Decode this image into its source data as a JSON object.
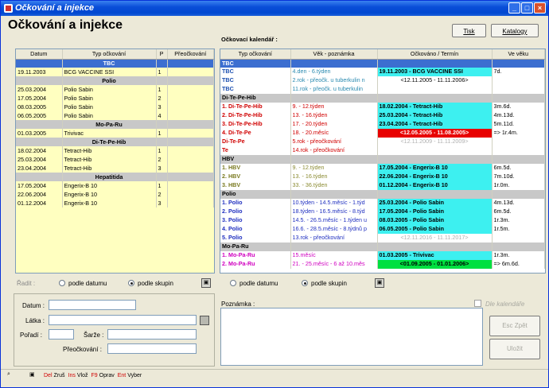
{
  "window": {
    "title": "Očkování a injekce"
  },
  "heading": "Očkování a injekce",
  "buttons": {
    "tisk": "Tisk",
    "katalogy": "Katalogy",
    "esc": "Esc Zpět",
    "ulozit": "Uložit"
  },
  "calendar_label": "Očkovací kalendář :",
  "left_table": {
    "headers": [
      "Datum",
      "Typ očkování",
      "P",
      "Přeočkování"
    ],
    "rows": [
      {
        "g": true,
        "t": "TBC",
        "sel": true
      },
      {
        "d": "19.11.2003",
        "t": "BCG VACCINE SSI",
        "p": "1"
      },
      {
        "g": true,
        "t": "Polio"
      },
      {
        "d": "25.03.2004",
        "t": "Polio Sabin",
        "p": "1"
      },
      {
        "d": "17.05.2004",
        "t": "Polio Sabin",
        "p": "2"
      },
      {
        "d": "08.03.2005",
        "t": "Polio Sabin",
        "p": "3"
      },
      {
        "d": "06.05.2005",
        "t": "Polio Sabin",
        "p": "4"
      },
      {
        "g": true,
        "t": "Mo-Pa-Ru"
      },
      {
        "d": "01.03.2005",
        "t": "Trivivac",
        "p": "1"
      },
      {
        "g": true,
        "t": "Di-Te-Pe-Hib"
      },
      {
        "d": "18.02.2004",
        "t": "Tetract-Hib",
        "p": "1"
      },
      {
        "d": "25.03.2004",
        "t": "Tetract-Hib",
        "p": "2"
      },
      {
        "d": "23.04.2004",
        "t": "Tetract-Hib",
        "p": "3"
      },
      {
        "g": true,
        "t": "Hepatitida"
      },
      {
        "d": "17.05.2004",
        "t": "Engerix-B 10",
        "p": "1"
      },
      {
        "d": "22.06.2004",
        "t": "Engerix-B 10",
        "p": "2"
      },
      {
        "d": "01.12.2004",
        "t": "Engerix-B 10",
        "p": "3"
      }
    ]
  },
  "right_table": {
    "headers": [
      "Typ očkování",
      "Věk - poznámka",
      "Očkováno / Termín",
      "Ve věku"
    ],
    "rows": [
      {
        "sel": true,
        "a": "TBC"
      },
      {
        "a": "TBC",
        "b": "4.den - 6.týden",
        "c": "19.11.2003 - BCG VACCINE SSI",
        "d": "7d.",
        "ac": "#1b4fb0",
        "bc": "#2a8ab0",
        "cc": "cyan"
      },
      {
        "a": "TBC",
        "b": "2.rok - přeočk. u tuberkulin n",
        "c": "<12.11.2005 - 11.11.2006>",
        "ac": "#1b4fb0",
        "bc": "#2a8ab0"
      },
      {
        "a": "TBC",
        "b": "11.rok - přeočk. u tuberkulin",
        "ac": "#1b4fb0",
        "bc": "#2a8ab0"
      },
      {
        "g": true,
        "a": "Di-Te-Pe-Hib"
      },
      {
        "a": "1. Di-Te-Pe-Hib",
        "b": "9. - 12.týden",
        "c": "18.02.2004 - Tetract-Hib",
        "d": "3m.6d.",
        "ac": "#d00000",
        "bc": "#d00000",
        "cc": "cyan"
      },
      {
        "a": "2. Di-Te-Pe-Hib",
        "b": "13. - 16.týden",
        "c": "25.03.2004 - Tetract-Hib",
        "d": "4m.13d.",
        "ac": "#d00000",
        "bc": "#d00000",
        "cc": "cyan"
      },
      {
        "a": "3. Di-Te-Pe-Hib",
        "b": "17. - 20.týden",
        "c": "23.04.2004 - Tetract-Hib",
        "d": "5m.11d.",
        "ac": "#d00000",
        "bc": "#d00000",
        "cc": "cyan"
      },
      {
        "a": "4. Di-Te-Pe",
        "b": "18. - 20.měsíc",
        "c": "<12.05.2005 - 11.08.2005>",
        "d": "=> 1r.4m.",
        "ac": "#d00000",
        "bc": "#d00000",
        "cc": "red"
      },
      {
        "a": "Di-Te-Pe",
        "b": "5.rok - přeočkování",
        "c": "<12.11.2009 - 11.11.2009>",
        "ac": "#d00000",
        "bc": "#d00000",
        "cg": true
      },
      {
        "a": "Te",
        "b": "14.rok - přeočkování",
        "ac": "#d00000",
        "bc": "#d00000"
      },
      {
        "g": true,
        "a": "HBV"
      },
      {
        "a": "1. HBV",
        "b": "9. - 12.týden",
        "c": "17.05.2004 - Engerix-B 10",
        "d": "6m.5d.",
        "ac": "#7a7a20",
        "bc": "#8a8a30",
        "cc": "cyan"
      },
      {
        "a": "2. HBV",
        "b": "13. - 16.týden",
        "c": "22.06.2004 - Engerix-B 10",
        "d": "7m.10d.",
        "ac": "#7a7a20",
        "bc": "#8a8a30",
        "cc": "cyan"
      },
      {
        "a": "3. HBV",
        "b": "33. - 36.týden",
        "c": "01.12.2004 - Engerix-B 10",
        "d": "1r.0m.",
        "ac": "#7a7a20",
        "bc": "#8a8a30",
        "cc": "cyan"
      },
      {
        "g": true,
        "a": "Polio"
      },
      {
        "a": "1. Polio",
        "b": "10.týden - 14.5.měsíc - 1.týd",
        "c": "25.03.2004 - Polio Sabin",
        "d": "4m.13d.",
        "ac": "#2030c0",
        "bc": "#2030c0",
        "cc": "cyan"
      },
      {
        "a": "2. Polio",
        "b": "18.týden - 16.5.měsíc - 8.týd",
        "c": "17.05.2004 - Polio Sabin",
        "d": "6m.5d.",
        "ac": "#2030c0",
        "bc": "#2030c0",
        "cc": "cyan"
      },
      {
        "a": "3. Polio",
        "b": "14.5. - 26.5.měsíc - 1.týden u",
        "c": "08.03.2005 - Polio Sabin",
        "d": "1r.3m.",
        "ac": "#2030c0",
        "bc": "#2030c0",
        "cc": "cyan"
      },
      {
        "a": "4. Polio",
        "b": "16.6. - 28.5.měsíc - 8.týdnů p",
        "c": "06.05.2005 - Polio Sabin",
        "d": "1r.5m.",
        "ac": "#2030c0",
        "bc": "#2030c0",
        "cc": "cyan"
      },
      {
        "a": "5. Polio",
        "b": "13.rok - přeočkování",
        "c": "<12.11.2016 - 11.11.2017>",
        "ac": "#2030c0",
        "bc": "#2030c0",
        "cg": true
      },
      {
        "g": true,
        "a": "Mo-Pa-Ru"
      },
      {
        "a": "1. Mo-Pa-Ru",
        "b": "15.měsíc",
        "c": "01.03.2005 - Trivivac",
        "d": "1r.3m.",
        "ac": "#d000c0",
        "bc": "#d000c0",
        "cc": "cyan"
      },
      {
        "a": "2. Mo-Pa-Ru",
        "b": "21. - 25.měsíc - 6 až 10.měs",
        "c": "<01.09.2005 - 01.01.2006>",
        "d": "=> 6m.6d.",
        "ac": "#d000c0",
        "bc": "#d000c0",
        "cc": "green"
      }
    ]
  },
  "sort": {
    "label": "Řadit :",
    "opt1": "podle datumu",
    "opt2": "podle skupin"
  },
  "sort2": {
    "opt1": "podle datumu",
    "opt2": "podle skupin"
  },
  "form": {
    "datum": "Datum :",
    "latka": "Látka :",
    "poradi": "Pořadí :",
    "sarze": "Šarže :",
    "preockovani": "Přeočkování :",
    "poznamka": "Poznámka :",
    "kalendar": "Dle kalendáře"
  },
  "statusbar": [
    {
      "k": "Del",
      "v": "Zruš"
    },
    {
      "k": "Ins",
      "v": "Vlož"
    },
    {
      "k": "F9",
      "v": "Oprav"
    },
    {
      "k": "Ent",
      "v": "Vyber"
    }
  ],
  "colors": {
    "title_bar": "#0a4ed8",
    "cyan": "#3df0f0",
    "red": "#e80000",
    "green": "#00e040",
    "yellow": "#ffffc0"
  }
}
